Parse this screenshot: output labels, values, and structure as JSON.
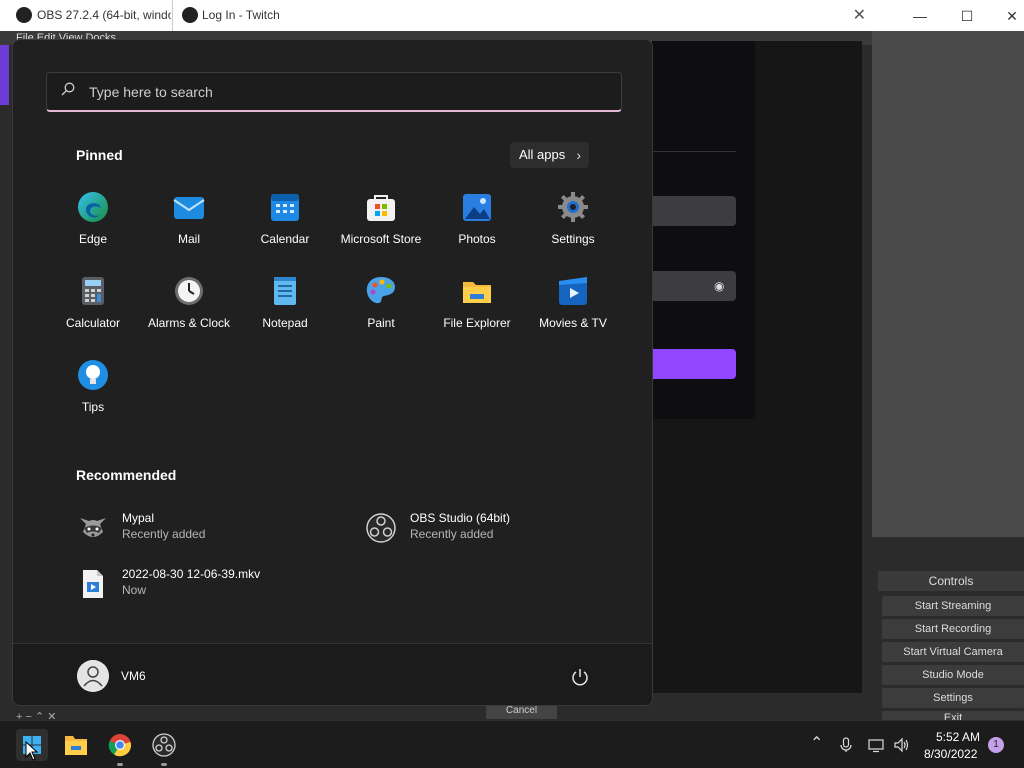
{
  "obs": {
    "title": "OBS 27.2.4 (64-bit, windo",
    "menu": "File  Edit  View  Docks",
    "controls": {
      "header": "Controls",
      "buttons": [
        "Start Streaming",
        "Start Recording",
        "Start Virtual Camera",
        "Studio Mode",
        "Settings",
        "Exit"
      ]
    },
    "cancel_label": "Cancel",
    "scene_tools": "+ − ⌃ ✕"
  },
  "browser": {
    "tab_title": "Log In - Twitch",
    "close_glyph": "✕",
    "eye_glyph": "◉"
  },
  "window_controls": {
    "minimize": "—",
    "maximize": "☐",
    "close": "✕"
  },
  "start_menu": {
    "search_placeholder": "Type here to search",
    "pinned_heading": "Pinned",
    "all_apps_label": "All apps",
    "all_apps_chevron": "›",
    "pinned_apps": [
      {
        "label": "Edge",
        "icon": "edge-icon"
      },
      {
        "label": "Mail",
        "icon": "mail-icon"
      },
      {
        "label": "Calendar",
        "icon": "calendar-icon"
      },
      {
        "label": "Microsoft Store",
        "icon": "store-icon"
      },
      {
        "label": "Photos",
        "icon": "photos-icon"
      },
      {
        "label": "Settings",
        "icon": "gear-icon"
      },
      {
        "label": "Calculator",
        "icon": "calculator-icon"
      },
      {
        "label": "Alarms & Clock",
        "icon": "clock-icon"
      },
      {
        "label": "Notepad",
        "icon": "notepad-icon"
      },
      {
        "label": "Paint",
        "icon": "paint-icon"
      },
      {
        "label": "File Explorer",
        "icon": "folder-icon"
      },
      {
        "label": "Movies & TV",
        "icon": "movies-icon"
      },
      {
        "label": "Tips",
        "icon": "lightbulb-icon"
      }
    ],
    "recommended_heading": "Recommended",
    "recommended": [
      {
        "name": "Mypal",
        "sub": "Recently added",
        "icon": "raccoon-icon"
      },
      {
        "name": "OBS Studio (64bit)",
        "sub": "Recently added",
        "icon": "obs-icon"
      },
      {
        "name": "2022-08-30 12-06-39.mkv",
        "sub": "Now",
        "icon": "video-file-icon"
      }
    ],
    "user_name": "VM6"
  },
  "taskbar": {
    "clock_time": "5:52 AM",
    "clock_date": "8/30/2022",
    "notification_count": "1",
    "tray_chevron": "⌃"
  },
  "colors": {
    "accent_purple": "#9147ff",
    "start_bg": "#202020",
    "search_underline": "#e6b8d8"
  }
}
